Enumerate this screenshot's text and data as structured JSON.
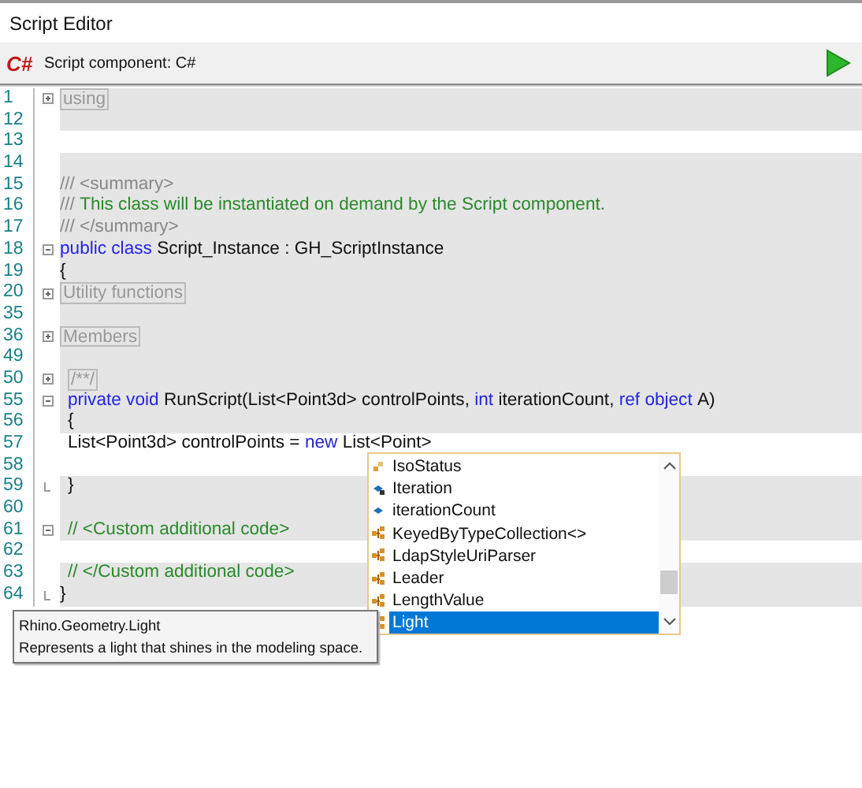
{
  "window": {
    "title": "Script Editor"
  },
  "toolbar": {
    "logo": "C#",
    "label": "Script component: C#"
  },
  "lines": [
    {
      "number": "1",
      "shaded": true,
      "indented": false,
      "kind": "collapsed",
      "tokens": [
        {
          "kind": "region",
          "text": "using"
        }
      ]
    },
    {
      "number": "12",
      "shaded": true,
      "kind": "plain"
    },
    {
      "number": "13",
      "shaded": false,
      "kind": "plain"
    },
    {
      "number": "14",
      "shaded": true,
      "kind": "plain"
    },
    {
      "number": "15",
      "shaded": true,
      "indented": false,
      "kind": "plain",
      "tokens": [
        {
          "kind": "doc",
          "text": "/// <summary>"
        }
      ]
    },
    {
      "number": "16",
      "shaded": true,
      "indented": false,
      "kind": "plain",
      "tokens": [
        {
          "kind": "doc",
          "text": "///"
        },
        {
          "kind": "comment",
          "text": "This class will be instantiated on demand by the Script component."
        }
      ]
    },
    {
      "number": "17",
      "shaded": true,
      "indented": false,
      "kind": "plain",
      "tokens": [
        {
          "kind": "doc",
          "text": "/// </summary>"
        }
      ]
    },
    {
      "number": "18",
      "shaded": true,
      "indented": false,
      "kind": "expanded",
      "tokens": [
        {
          "kind": "keyword",
          "text": "public class"
        },
        {
          "kind": "text",
          "text": "Script_Instance : GH_ScriptInstance"
        }
      ]
    },
    {
      "number": "19",
      "shaded": true,
      "indented": false,
      "kind": "plain",
      "tokens": [
        {
          "kind": "text",
          "text": "{"
        }
      ]
    },
    {
      "number": "20",
      "shaded": true,
      "indented": false,
      "kind": "collapsed",
      "tokens": [
        {
          "kind": "region",
          "text": "Utility functions"
        }
      ]
    },
    {
      "number": "35",
      "shaded": true,
      "kind": "plain"
    },
    {
      "number": "36",
      "shaded": true,
      "indented": false,
      "kind": "collapsed",
      "tokens": [
        {
          "kind": "region",
          "text": "Members"
        }
      ]
    },
    {
      "number": "49",
      "shaded": true,
      "kind": "plain"
    },
    {
      "number": "50",
      "shaded": true,
      "indented": true,
      "kind": "collapsed",
      "tokens": [
        {
          "kind": "region",
          "text": "/**/"
        }
      ]
    },
    {
      "number": "55",
      "shaded": true,
      "indented": true,
      "kind": "expanded",
      "tokens": [
        {
          "kind": "keyword",
          "text": "private void"
        },
        {
          "kind": "text",
          "text": "RunScript(List<Point3d> controlPoints,"
        },
        {
          "kind": "keyword",
          "text": "int"
        },
        {
          "kind": "text",
          "text": "iterationCount,"
        },
        {
          "kind": "keyword",
          "text": "ref object"
        },
        {
          "kind": "text",
          "text": "A)"
        }
      ]
    },
    {
      "number": "56",
      "shaded": true,
      "indented": true,
      "kind": "plain",
      "tokens": [
        {
          "kind": "text",
          "text": "{"
        }
      ]
    },
    {
      "number": "57",
      "shaded": false,
      "indented": true,
      "kind": "plain",
      "tokens": [
        {
          "kind": "text",
          "text": "List<Point3d> controlPoints ="
        },
        {
          "kind": "keyword",
          "text": "new"
        },
        {
          "kind": "text",
          "text": "List<Point>"
        }
      ]
    },
    {
      "number": "58",
      "shaded": false,
      "kind": "plain"
    },
    {
      "number": "59",
      "shaded": true,
      "indented": true,
      "kind": "end",
      "tokens": [
        {
          "kind": "text",
          "text": "}"
        }
      ]
    },
    {
      "number": "60",
      "shaded": true,
      "kind": "plain"
    },
    {
      "number": "61",
      "shaded": true,
      "indented": true,
      "kind": "expanded",
      "tokens": [
        {
          "kind": "comment",
          "text": "// <Custom additional code>"
        }
      ]
    },
    {
      "number": "62",
      "shaded": false,
      "kind": "plain"
    },
    {
      "number": "63",
      "shaded": true,
      "indented": true,
      "kind": "plain",
      "tokens": [
        {
          "kind": "comment",
          "text": "// </Custom additional code>"
        }
      ]
    },
    {
      "number": "64",
      "shaded": true,
      "indented": false,
      "kind": "end",
      "tokens": [
        {
          "kind": "text",
          "text": "}"
        }
      ]
    }
  ],
  "completion": {
    "items": [
      {
        "label": "IsoStatus",
        "kind": "property",
        "selected": false
      },
      {
        "label": "Iteration",
        "kind": "event",
        "selected": false
      },
      {
        "label": "iterationCount",
        "kind": "field",
        "selected": false
      },
      {
        "label": "KeyedByTypeCollection<>",
        "kind": "class",
        "selected": false
      },
      {
        "label": "LdapStyleUriParser",
        "kind": "class",
        "selected": false
      },
      {
        "label": "Leader",
        "kind": "class",
        "selected": false
      },
      {
        "label": "LengthValue",
        "kind": "class",
        "selected": false
      },
      {
        "label": "Light",
        "kind": "class",
        "selected": true
      }
    ]
  },
  "tooltip": {
    "title": "Rhino.Geometry.Light",
    "description": "Represents a light that shines in the modeling space."
  }
}
